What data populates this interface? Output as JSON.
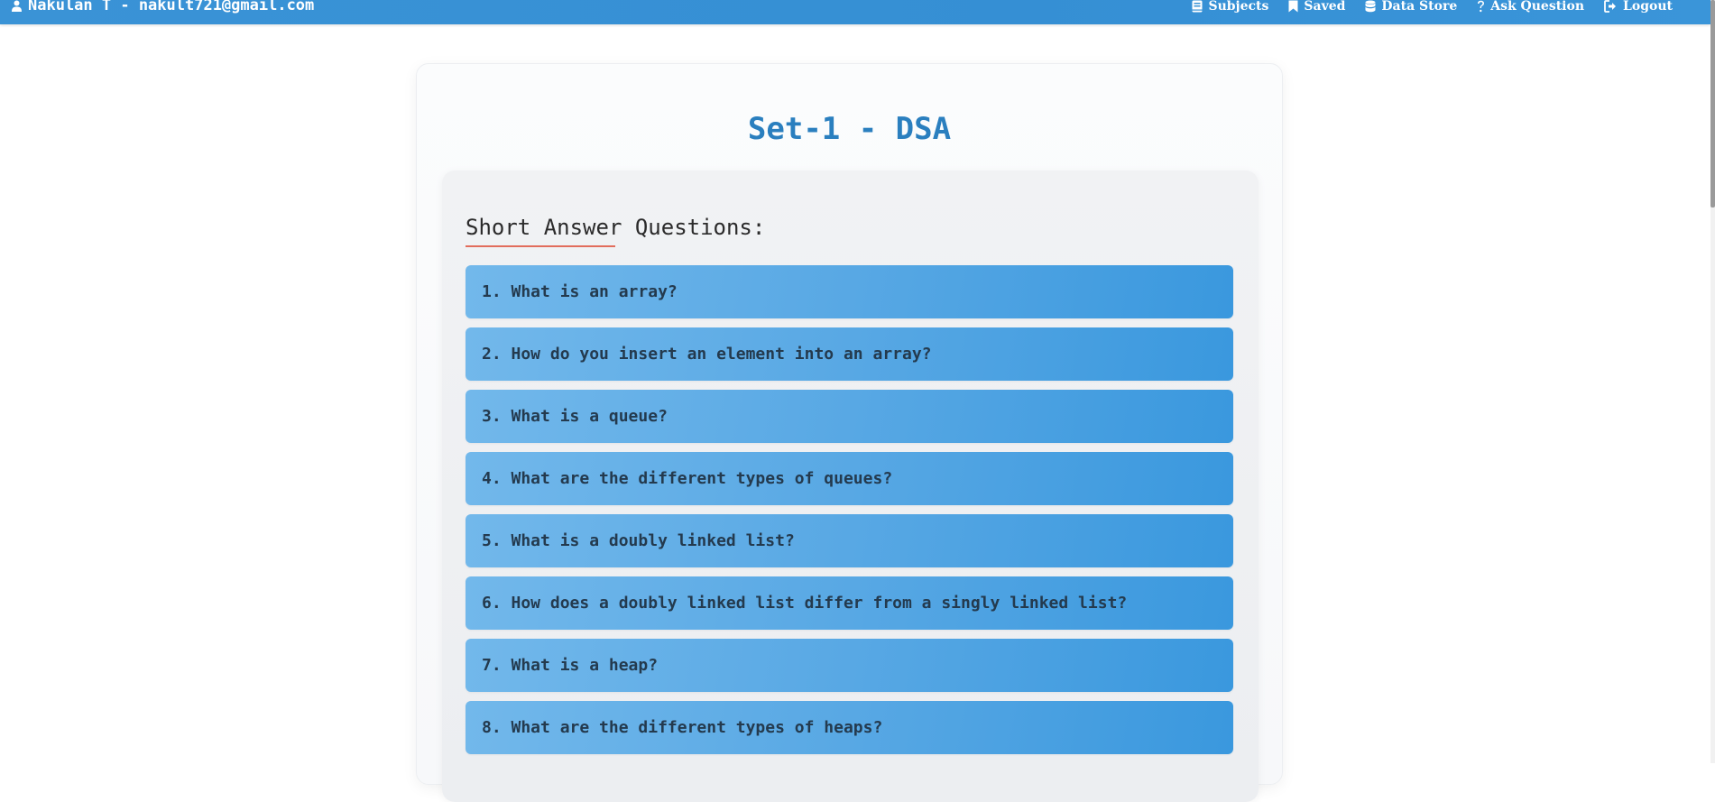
{
  "header": {
    "user_label": "Nakulan T - nakult721@gmail.com",
    "nav": [
      {
        "label": "Subjects",
        "icon": "book-icon"
      },
      {
        "label": "Saved",
        "icon": "bookmark-icon"
      },
      {
        "label": "Data Store",
        "icon": "database-icon"
      },
      {
        "label": "Ask Question",
        "icon": "question-icon"
      },
      {
        "label": "Logout",
        "icon": "logout-icon"
      }
    ]
  },
  "main": {
    "title": "Set-1 - DSA",
    "section": {
      "heading": "Short Answer Questions:",
      "questions": [
        "1. What is an array?",
        "2. How do you insert an element into an array?",
        "3. What is a queue?",
        "4. What are the different types of queues?",
        "5. What is a doubly linked list?",
        "6. How does a doubly linked list differ from a singly linked list?",
        "7. What is a heap?",
        "8. What are the different types of heaps?"
      ]
    }
  },
  "colors": {
    "header_bg": "#3a93d6",
    "title": "#2a7fbf",
    "question_bg_start": "#72b8eb",
    "question_bg_end": "#3a98de",
    "question_text": "#243a4e",
    "underline_accent": "#e26d5c"
  }
}
